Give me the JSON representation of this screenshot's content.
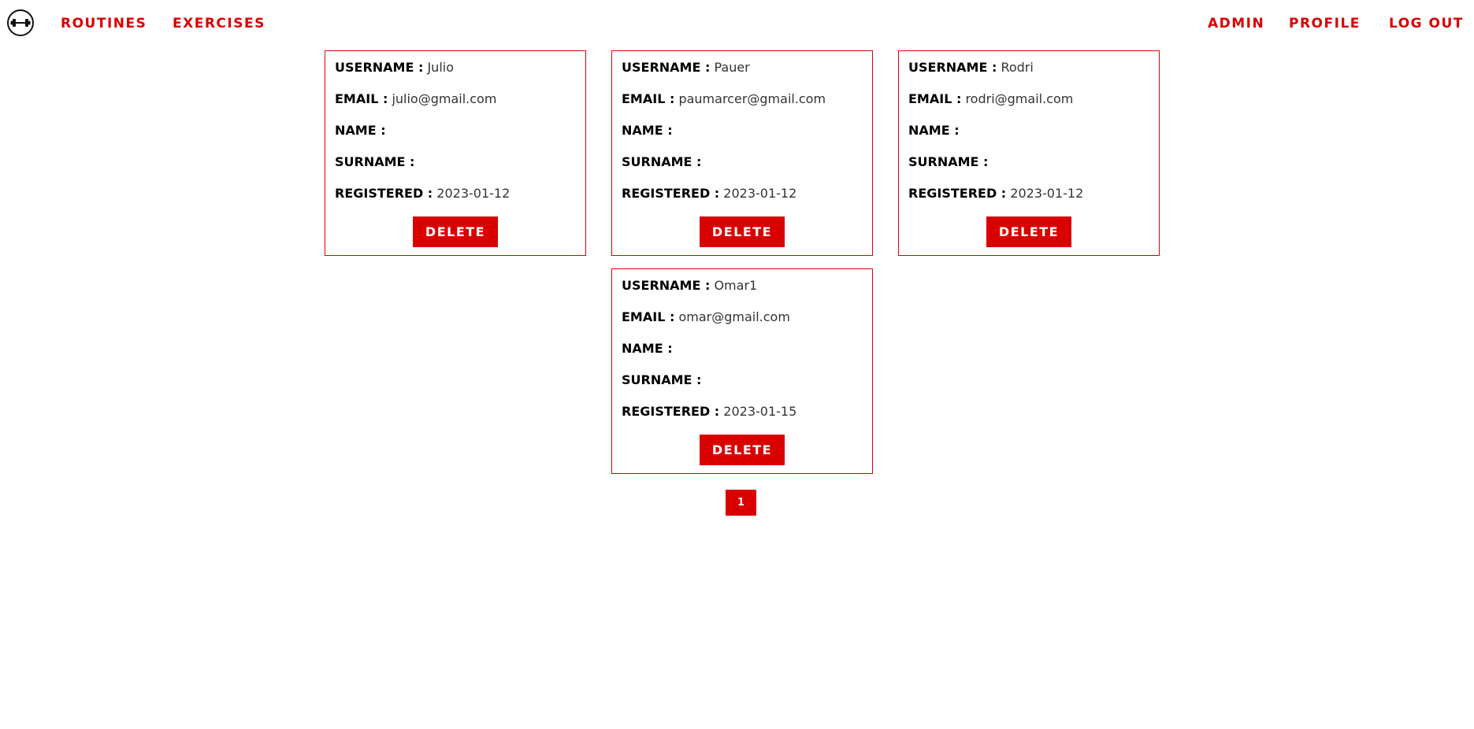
{
  "nav": {
    "logo_icon": "dumbbell-icon",
    "left_links": [
      "ROUTINES",
      "EXERCISES"
    ],
    "right_links": [
      "ADMIN",
      "PROFILE",
      "LOG OUT"
    ],
    "accent_color": "#d90000"
  },
  "labels": {
    "username": "USERNAME :",
    "email": "EMAIL :",
    "name": "NAME :",
    "surname": "SURNAME :",
    "registered": "REGISTERED :",
    "delete": "DELETE"
  },
  "users": [
    {
      "username": "Julio",
      "email": "julio@gmail.com",
      "name": "",
      "surname": "",
      "registered": "2023-01-12"
    },
    {
      "username": "Pauer",
      "email": "paumarcer@gmail.com",
      "name": "",
      "surname": "",
      "registered": "2023-01-12"
    },
    {
      "username": "Rodri",
      "email": "rodri@gmail.com",
      "name": "",
      "surname": "",
      "registered": "2023-01-12"
    },
    {
      "username": "Omar1",
      "email": "omar@gmail.com",
      "name": "",
      "surname": "",
      "registered": "2023-01-15"
    }
  ],
  "pagination": {
    "pages": [
      "1"
    ]
  }
}
